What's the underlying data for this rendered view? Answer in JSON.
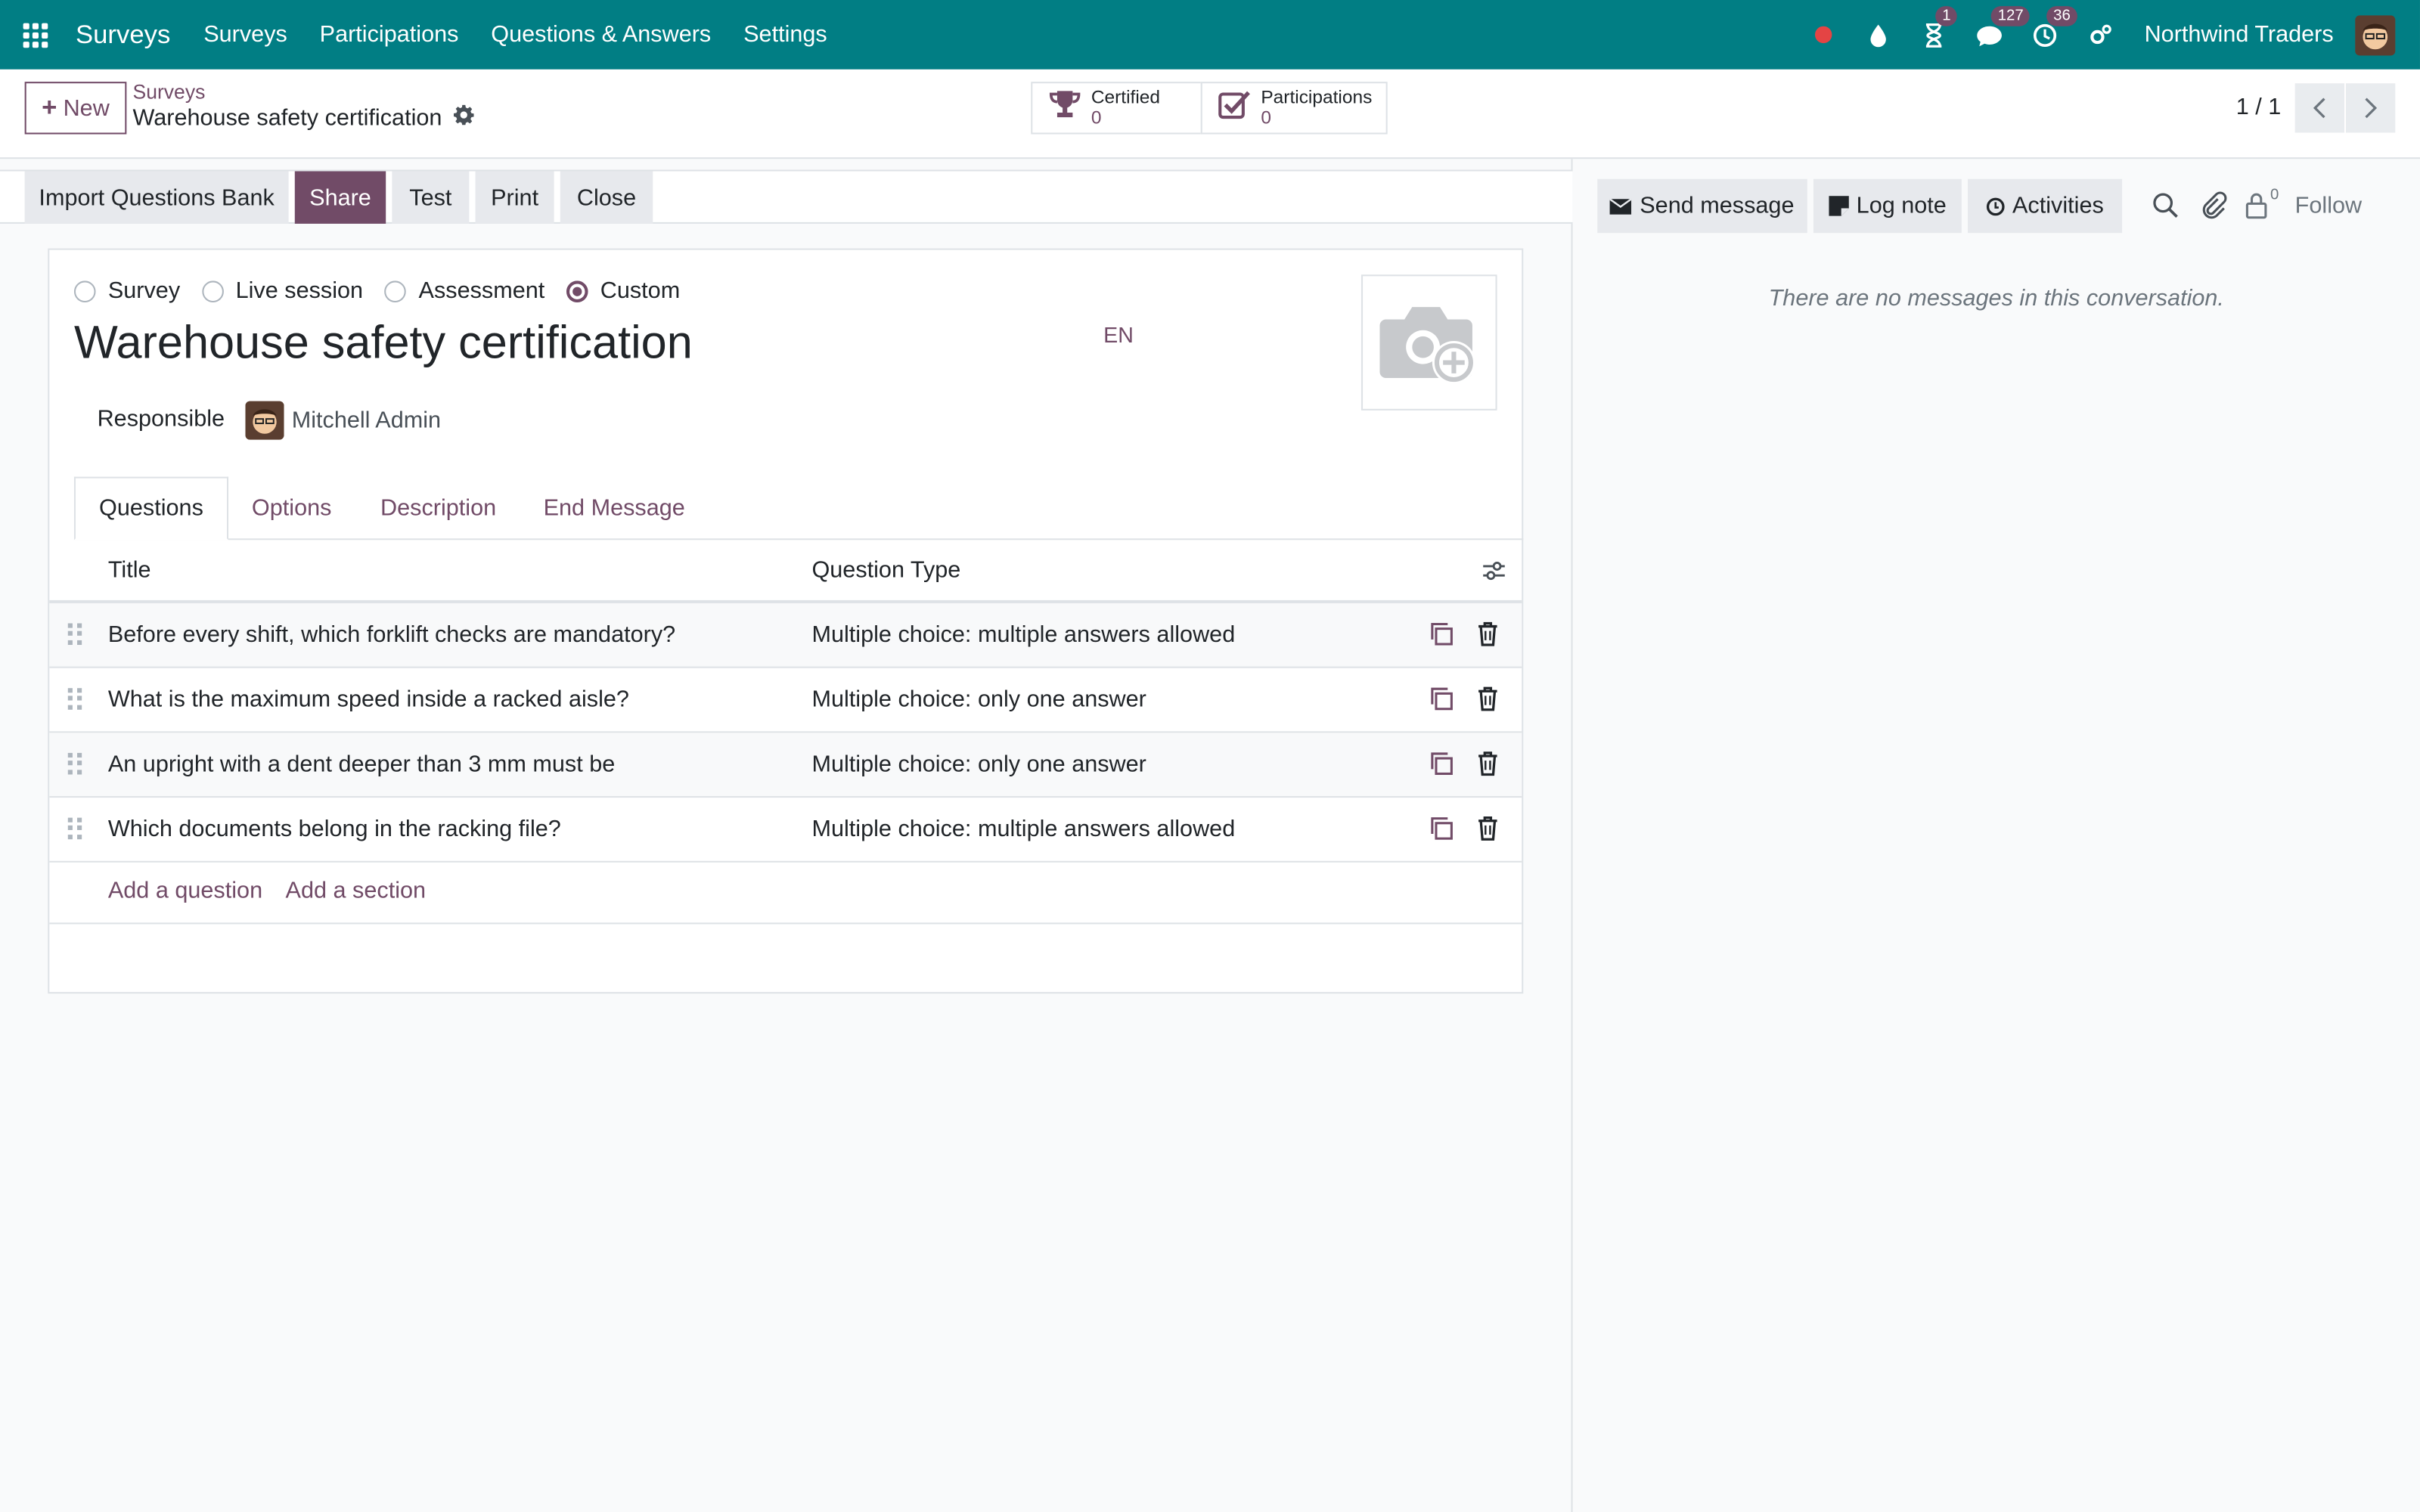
{
  "topbar": {
    "app_name": "Surveys",
    "menu": [
      "Surveys",
      "Participations",
      "Questions & Answers",
      "Settings"
    ],
    "activity_badge": "1",
    "messages_badge": "127",
    "clock_badge": "36",
    "company": "Northwind Traders"
  },
  "control": {
    "new_label": "New",
    "breadcrumb": "Surveys",
    "record_name": "Warehouse safety certification",
    "stats": [
      {
        "label": "Certified",
        "value": "0"
      },
      {
        "label": "Participations",
        "value": "0"
      }
    ],
    "pager": "1 / 1"
  },
  "statusbar": {
    "buttons": [
      "Import Questions Bank",
      "Share",
      "Test",
      "Print",
      "Close"
    ]
  },
  "form": {
    "survey_types": [
      "Survey",
      "Live session",
      "Assessment",
      "Custom"
    ],
    "selected_type": "Custom",
    "title": "Warehouse safety certification",
    "lang": "EN",
    "responsible_label": "Responsible",
    "responsible_name": "Mitchell Admin",
    "tabs": [
      "Questions",
      "Options",
      "Description",
      "End Message"
    ],
    "active_tab": "Questions",
    "columns": {
      "title": "Title",
      "type": "Question Type"
    },
    "rows": [
      {
        "title": "Before every shift, which forklift checks are mandatory?",
        "type": "Multiple choice: multiple answers allowed"
      },
      {
        "title": "What is the maximum speed inside a racked aisle?",
        "type": "Multiple choice: only one answer"
      },
      {
        "title": "An upright with a dent deeper than 3 mm must be",
        "type": "Multiple choice: only one answer"
      },
      {
        "title": "Which documents belong in the racking file?",
        "type": "Multiple choice: multiple answers allowed"
      }
    ],
    "add_question": "Add a question",
    "add_section": "Add a section"
  },
  "chatter": {
    "send_message": "Send message",
    "log_note": "Log note",
    "activities": "Activities",
    "followers_count": "0",
    "follow": "Follow",
    "empty_message": "There are no messages in this conversation."
  },
  "colors": {
    "navbar": "#017e84",
    "primary": "#714b67",
    "background": "#f9fafb"
  }
}
